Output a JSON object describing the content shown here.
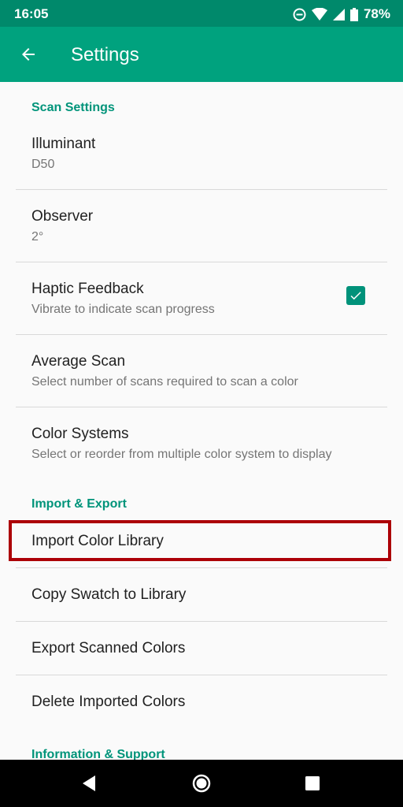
{
  "status_bar": {
    "time": "16:05",
    "battery": "78%",
    "icons": [
      "do-not-disturb-icon",
      "wifi-icon",
      "signal-icon",
      "battery-icon"
    ]
  },
  "app_bar": {
    "title": "Settings",
    "back_icon": "back-arrow-icon",
    "color": "#00a27e"
  },
  "sections": {
    "scan_settings": "Scan Settings",
    "import_export": "Import & Export",
    "info_support": "Information & Support"
  },
  "prefs": {
    "illuminant": {
      "title": "Illuminant",
      "summary": "D50"
    },
    "observer": {
      "title": "Observer",
      "summary": "2°"
    },
    "haptic": {
      "title": "Haptic Feedback",
      "summary": "Vibrate to indicate scan progress",
      "checked": true
    },
    "average_scan": {
      "title": "Average Scan",
      "summary": "Select number of scans required to scan a color"
    },
    "color_systems": {
      "title": "Color Systems",
      "summary": "Select or reorder from multiple color system to display"
    },
    "import_library": {
      "title": "Import Color Library"
    },
    "copy_swatch": {
      "title": "Copy Swatch to Library"
    },
    "export_scanned": {
      "title": "Export Scanned Colors"
    },
    "delete_imported": {
      "title": "Delete Imported Colors"
    }
  },
  "nav_bar": {
    "icons": [
      "back-triangle-icon",
      "home-circle-icon",
      "recents-square-icon"
    ]
  },
  "colors": {
    "accent": "#00947a",
    "highlight_border": "#ac0007"
  }
}
